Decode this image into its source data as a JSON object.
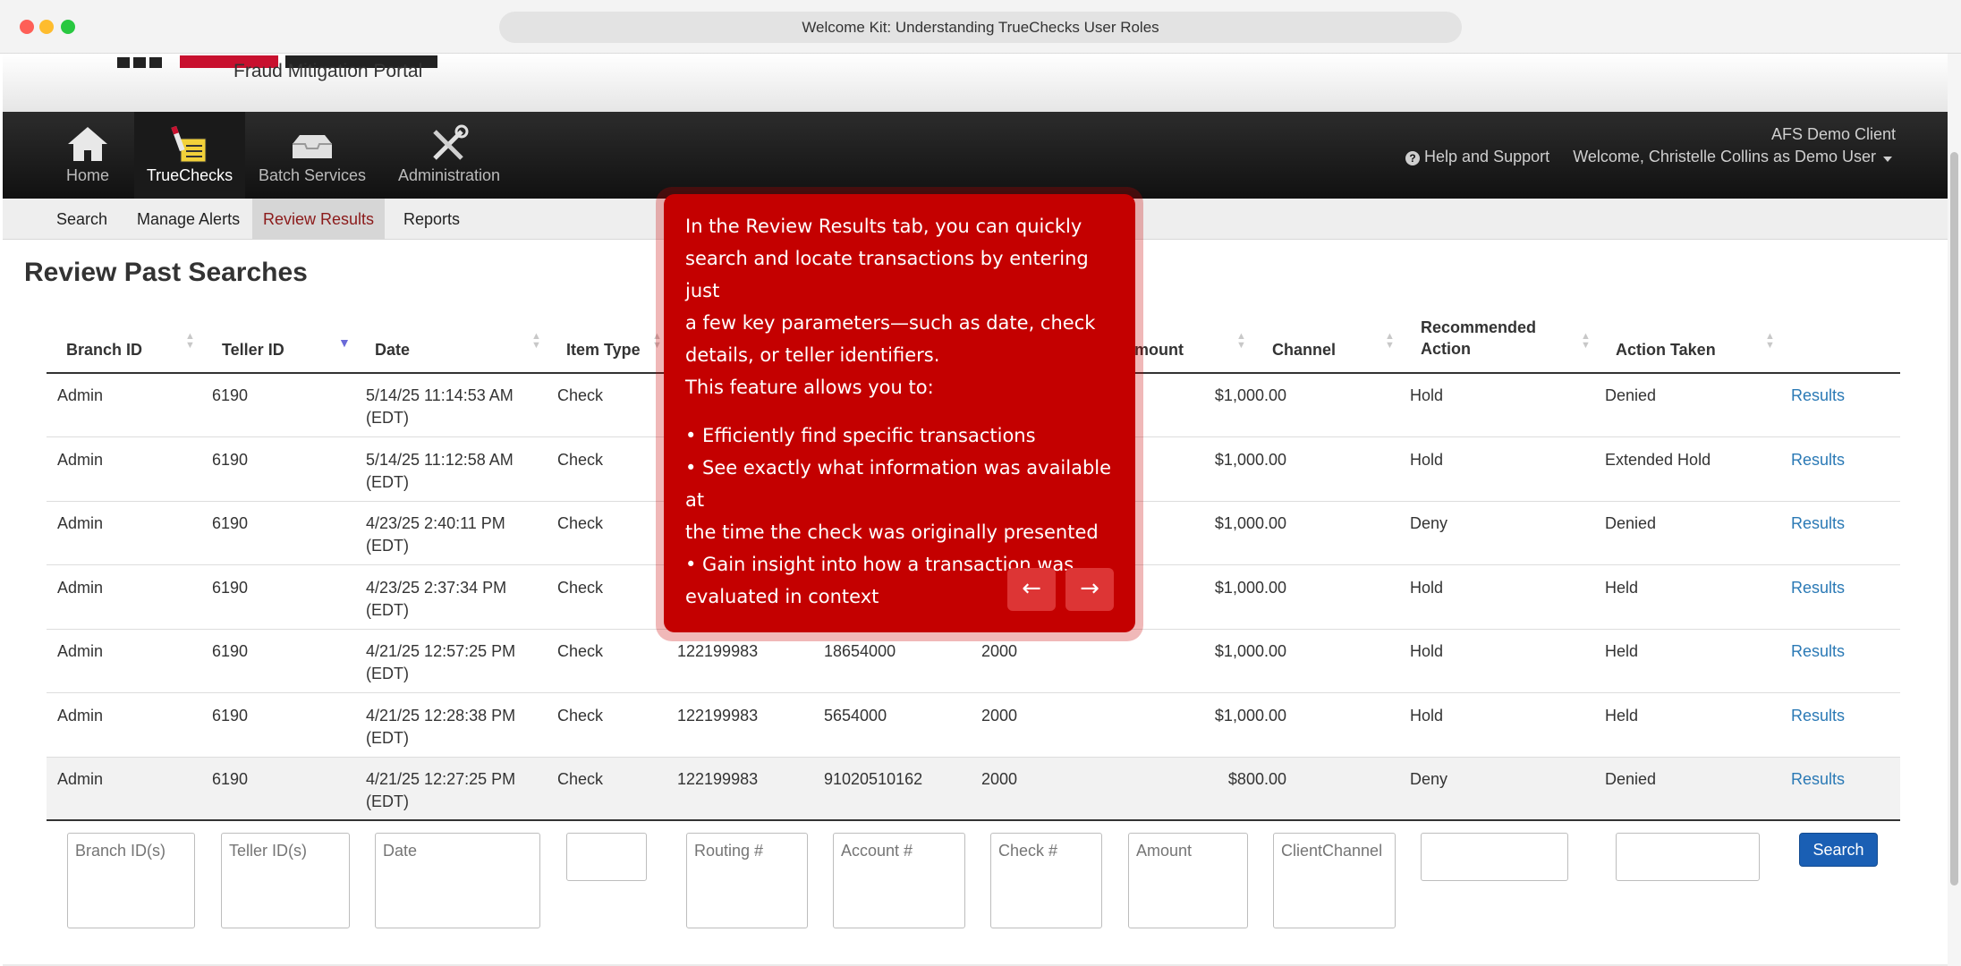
{
  "browser": {
    "title": "Welcome Kit: Understanding TrueChecks User Roles"
  },
  "header": {
    "subtitle": "Fraud Mitigation Portal",
    "client_name": "AFS Demo Client",
    "help_label": "Help and Support",
    "welcome_text": "Welcome, Christelle Collins as Demo User"
  },
  "nav": {
    "items": [
      {
        "label": "Home",
        "icon": "home-icon"
      },
      {
        "label": "TrueChecks",
        "icon": "truechecks-icon"
      },
      {
        "label": "Batch Services",
        "icon": "batch-services-icon"
      },
      {
        "label": "Administration",
        "icon": "administration-icon"
      }
    ]
  },
  "subnav": {
    "tabs": [
      "Search",
      "Manage Alerts",
      "Review Results",
      "Reports"
    ],
    "active": "Review Results"
  },
  "page": {
    "title": "Review Past Searches"
  },
  "table": {
    "columns": [
      "Branch ID",
      "Teller ID",
      "Date",
      "Item Type",
      "Amount",
      "Channel",
      "Recommended Action",
      "Action Taken"
    ],
    "columns_partial": {
      "amount_visible": "mount"
    },
    "recommended_action_lines": [
      "Recommended",
      "Action"
    ],
    "rows": [
      {
        "branch": "Admin",
        "teller": "6190",
        "date1": "5/14/25 11:14:53 AM",
        "date2": "(EDT)",
        "item_type": "Check",
        "routing": "",
        "account": "",
        "check": "",
        "amount": "$1,000.00",
        "channel": "",
        "recommended": "Hold",
        "taken": "Denied",
        "link": "Results"
      },
      {
        "branch": "Admin",
        "teller": "6190",
        "date1": "5/14/25 11:12:58 AM",
        "date2": "(EDT)",
        "item_type": "Check",
        "routing": "",
        "account": "",
        "check": "",
        "amount": "$1,000.00",
        "channel": "",
        "recommended": "Hold",
        "taken": "Extended Hold",
        "link": "Results"
      },
      {
        "branch": "Admin",
        "teller": "6190",
        "date1": "4/23/25 2:40:11 PM",
        "date2": "(EDT)",
        "item_type": "Check",
        "routing": "",
        "account": "",
        "check": "",
        "amount": "$1,000.00",
        "channel": "",
        "recommended": "Deny",
        "taken": "Denied",
        "link": "Results"
      },
      {
        "branch": "Admin",
        "teller": "6190",
        "date1": "4/23/25 2:37:34 PM",
        "date2": "(EDT)",
        "item_type": "Check",
        "routing": "",
        "account": "",
        "check": "",
        "amount": "$1,000.00",
        "channel": "",
        "recommended": "Hold",
        "taken": "Held",
        "link": "Results"
      },
      {
        "branch": "Admin",
        "teller": "6190",
        "date1": "4/21/25 12:57:25 PM",
        "date2": "(EDT)",
        "item_type": "Check",
        "routing": "122199983",
        "account": "18654000",
        "check": "2000",
        "amount": "$1,000.00",
        "channel": "",
        "recommended": "Hold",
        "taken": "Held",
        "link": "Results"
      },
      {
        "branch": "Admin",
        "teller": "6190",
        "date1": "4/21/25 12:28:38 PM",
        "date2": "(EDT)",
        "item_type": "Check",
        "routing": "122199983",
        "account": "5654000",
        "check": "2000",
        "amount": "$1,000.00",
        "channel": "",
        "recommended": "Hold",
        "taken": "Held",
        "link": "Results"
      },
      {
        "branch": "Admin",
        "teller": "6190",
        "date1": "4/21/25 12:27:25 PM",
        "date2": "(EDT)",
        "item_type": "Check",
        "routing": "122199983",
        "account": "91020510162",
        "check": "2000",
        "amount": "$800.00",
        "channel": "",
        "recommended": "Deny",
        "taken": "Denied",
        "link": "Results"
      }
    ]
  },
  "filters": {
    "branch_placeholder": "Branch ID(s)",
    "teller_placeholder": "Teller ID(s)",
    "date_placeholder": "Date",
    "routing_placeholder": "Routing #",
    "account_placeholder": "Account #",
    "check_placeholder": "Check #",
    "amount_placeholder": "Amount",
    "channel_placeholder": "ClientChannel",
    "search_label": "Search"
  },
  "tooltip": {
    "intro_lines": [
      "In the Review Results tab, you can quickly",
      "search and locate transactions by entering just",
      "a few key parameters—such as date, check",
      "details, or teller identifiers.",
      "This feature allows you to:"
    ],
    "bullet_lines": [
      "• Efficiently find specific transactions",
      "• See exactly what information was available at",
      "the time the check was originally presented",
      "• Gain insight into how a transaction was",
      "evaluated in context"
    ],
    "prev_label": "←",
    "next_label": "→"
  },
  "colors": {
    "tooltip_bg": "#c40000",
    "link": "#2a79b5",
    "search_button": "#1a5fb4",
    "active_subtab_text": "#8b1a1a"
  }
}
